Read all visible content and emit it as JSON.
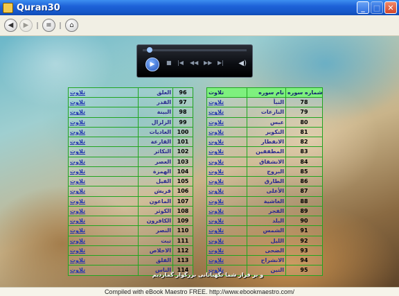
{
  "window": {
    "title": "Quran30",
    "buttons": {
      "minimize": "_",
      "maximize": "□",
      "close": "✕"
    }
  },
  "toolbar": {
    "back_icon": "◀",
    "forward_icon": "▶",
    "stop_icon": "≡",
    "home_icon": "⌂"
  },
  "player": {
    "play_icon": "▶",
    "controls": [
      "■",
      "|◀",
      "◀◀",
      "▶▶",
      "▶|"
    ],
    "volume_icon": "◀)"
  },
  "left_table": {
    "rows": [
      {
        "num": "96",
        "name": "العلق",
        "play": "تلاوت"
      },
      {
        "num": "97",
        "name": "القدر",
        "play": "تلاوت"
      },
      {
        "num": "98",
        "name": "البينة",
        "play": "تلاوت"
      },
      {
        "num": "99",
        "name": "الزلزال",
        "play": "تلاوت"
      },
      {
        "num": "100",
        "name": "العاديات",
        "play": "تلاوت"
      },
      {
        "num": "101",
        "name": "القارعة",
        "play": "تلاوت"
      },
      {
        "num": "102",
        "name": "التكاثر",
        "play": "تلاوت"
      },
      {
        "num": "103",
        "name": "العصر",
        "play": "تلاوت"
      },
      {
        "num": "104",
        "name": "الهمزة",
        "play": "تلاوت"
      },
      {
        "num": "105",
        "name": "الفيل",
        "play": "تلاوت"
      },
      {
        "num": "106",
        "name": "قريش",
        "play": "تلاوت"
      },
      {
        "num": "107",
        "name": "الماعون",
        "play": "تلاوت"
      },
      {
        "num": "108",
        "name": "الكوثر",
        "play": "تلاوت"
      },
      {
        "num": "109",
        "name": "الكافرون",
        "play": "تلاوت"
      },
      {
        "num": "110",
        "name": "النصر",
        "play": "تلاوت"
      },
      {
        "num": "111",
        "name": "تبت",
        "play": "تلاوت"
      },
      {
        "num": "112",
        "name": "الاخلاص",
        "play": "تلاوت"
      },
      {
        "num": "113",
        "name": "الفلق",
        "play": "تلاوت"
      },
      {
        "num": "114",
        "name": "الناس",
        "play": "تلاوت"
      }
    ]
  },
  "right_table": {
    "headers": {
      "num": "شماره سوره",
      "name": "نام سوره",
      "play": "تلاوت"
    },
    "rows": [
      {
        "num": "78",
        "name": "النبأ",
        "play": "تلاوت"
      },
      {
        "num": "79",
        "name": "النازعات",
        "play": "تلاوت"
      },
      {
        "num": "80",
        "name": "عبس",
        "play": "تلاوت"
      },
      {
        "num": "81",
        "name": "التكوير",
        "play": "تلاوت"
      },
      {
        "num": "82",
        "name": "الانفطار",
        "play": "تلاوت"
      },
      {
        "num": "83",
        "name": "المطففين",
        "play": "تلاوت"
      },
      {
        "num": "84",
        "name": "الانشقاق",
        "play": "تلاوت"
      },
      {
        "num": "85",
        "name": "البروج",
        "play": "تلاوت"
      },
      {
        "num": "86",
        "name": "الطارق",
        "play": "تلاوت"
      },
      {
        "num": "87",
        "name": "الأعلى",
        "play": "تلاوت"
      },
      {
        "num": "88",
        "name": "الغاشية",
        "play": "تلاوت"
      },
      {
        "num": "89",
        "name": "الفجر",
        "play": "تلاوت"
      },
      {
        "num": "90",
        "name": "البلد",
        "play": "تلاوت"
      },
      {
        "num": "91",
        "name": "الشمس",
        "play": "تلاوت"
      },
      {
        "num": "92",
        "name": "الليل",
        "play": "تلاوت"
      },
      {
        "num": "93",
        "name": "الضحى",
        "play": "تلاوت"
      },
      {
        "num": "94",
        "name": "الانشراح",
        "play": "تلاوت"
      },
      {
        "num": "95",
        "name": "التين",
        "play": "تلاوت"
      }
    ]
  },
  "verse_text": "و بر فراز شما نگهبانانی بزرگوار گماردیم",
  "footer": "Compiled with eBook Maestro FREE. http://www.ebookmaestro.com/"
}
